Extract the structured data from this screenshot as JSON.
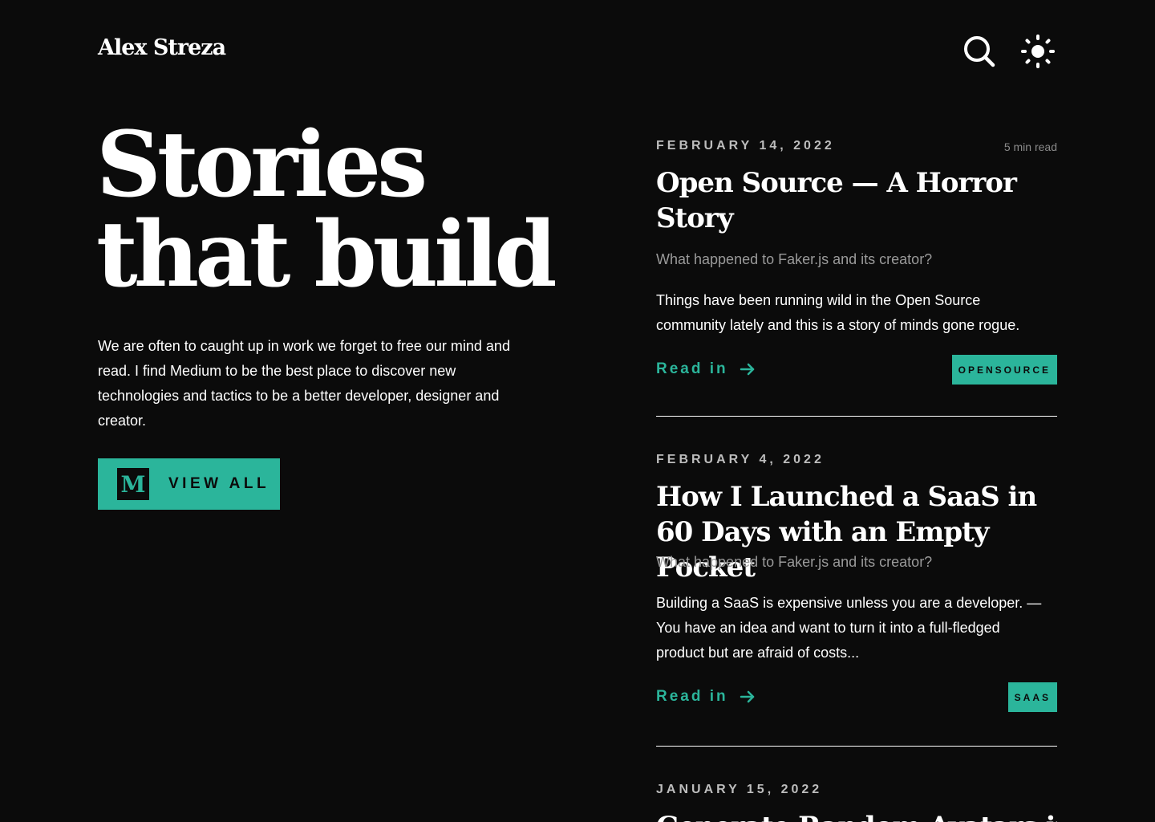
{
  "header": {
    "brand": "Alex Streza",
    "icons": [
      "search-icon",
      "sun-icon"
    ]
  },
  "hero": {
    "title_line1": "Stories",
    "title_line2": "that build",
    "description": "We are often to caught up in work we forget to free our mind and read. I find Medium to be the best place to discover new technologies and tactics to be a better developer, designer and creator.",
    "button_logo": "M",
    "button_label": "VIEW ALL"
  },
  "articles": [
    {
      "date": "FEBRUARY 14, 2022",
      "read_time": "5 min read",
      "title": "Open Source — A Horror Story",
      "subtitle": "What happened to Faker.js and its creator?",
      "excerpt": "Things have been running wild in the Open Source community lately and this is a story of minds gone rogue.",
      "link_label": "Read in",
      "tag": "OPENSOURCE"
    },
    {
      "date": "FEBRUARY 4, 2022",
      "title": "How I Launched a SaaS in 60 Days with an Empty Pocket",
      "subtitle": "What happened to Faker.js and its creator?",
      "excerpt": "Building a SaaS is expensive unless you are a developer. — You have an idea and want to turn it into a full-fledged product but are afraid of costs...",
      "link_label": "Read in",
      "tag": "SAAS"
    },
    {
      "date": "JANUARY 15, 2022",
      "title": "Generate Random Avatars in"
    }
  ],
  "colors": {
    "background": "#0b0b0b",
    "accent": "#2bb59b",
    "text": "#ffffff",
    "muted": "#9a9a9a"
  }
}
